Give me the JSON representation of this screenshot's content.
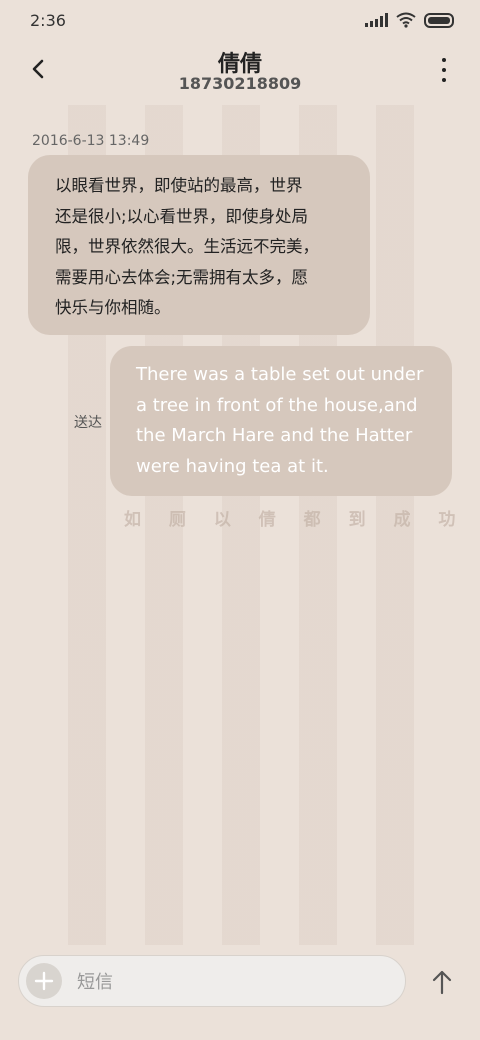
{
  "status_bar": {
    "time": "2:36",
    "icons": [
      "signal-icon",
      "wifi-icon",
      "battery-icon"
    ]
  },
  "header": {
    "contact_name": "倩倩",
    "phone_number": "18730218809",
    "back_icon": "chevron-left-icon",
    "more_icon": "more-vertical-icon"
  },
  "conversation": {
    "timestamp": "2016-6-13 13:49",
    "messages": [
      {
        "direction": "incoming",
        "lines": [
          "以眼看世界，即使站的最高，世界",
          "还是很小;以心看世界，即使身处局",
          "限，世界依然很大。生活远不完美，",
          "需要用心去体会;无需拥有太多，愿",
          "快乐与你相随。"
        ]
      },
      {
        "direction": "outgoing",
        "lines": [
          "There was a table set out under",
          "a tree in front of the house,and",
          "the March Hare and the Hatter",
          "were having tea at it."
        ],
        "status": "送达"
      }
    ],
    "watermark": "如 厕 以 倩 都 到 成 功"
  },
  "composer": {
    "placeholder": "短信",
    "add_icon": "plus-icon",
    "send_icon": "arrow-up-icon"
  },
  "colors": {
    "background": "#ebe1d9",
    "bubble": "#d6c8bd",
    "outgoing_text": "#ffffff"
  }
}
